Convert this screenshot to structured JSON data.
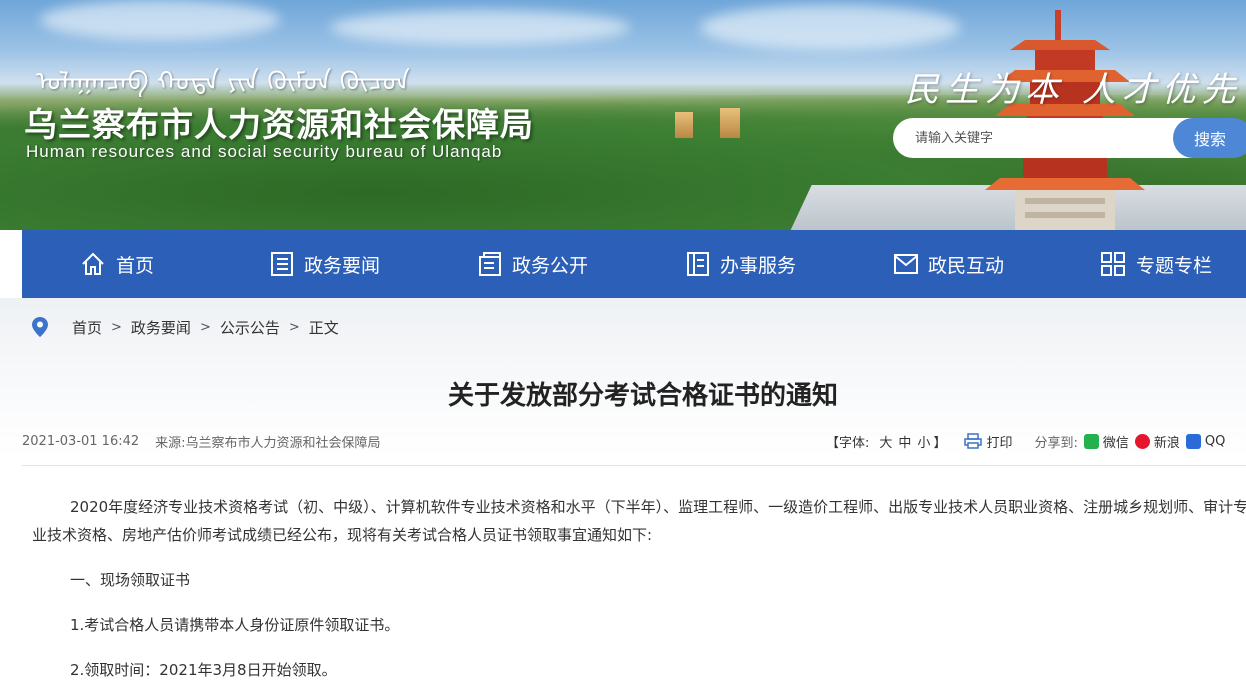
{
  "header": {
    "mongolian_title": "ᠤᠯᠠᠭᠠᠨᠴᠠᠪ ᠬᠣᠲᠠ ᠶᠢᠨ ᠬᠦᠮᠦᠨ ᠬᠦᠴᠦᠨ",
    "title": "乌兰察布市人力资源和社会保障局",
    "subtitle": "Human resources and social security bureau of Ulanqab",
    "slogan": "民生为本 人才优先"
  },
  "search": {
    "placeholder": "请输入关键字",
    "button_label": "搜索",
    "accent_color": "#4e87d6"
  },
  "nav": {
    "color": "#2c5fb8",
    "items": [
      {
        "label": "首页",
        "icon": "home-icon"
      },
      {
        "label": "政务要闻",
        "icon": "news-list-icon"
      },
      {
        "label": "政务公开",
        "icon": "open-affairs-icon"
      },
      {
        "label": "办事服务",
        "icon": "service-icon"
      },
      {
        "label": "政民互动",
        "icon": "mail-icon"
      },
      {
        "label": "专题专栏",
        "icon": "grid-icon"
      }
    ]
  },
  "breadcrumb": {
    "icon": "location-pin-icon",
    "items": [
      "首页",
      "政务要闻",
      "公示公告",
      "正文"
    ],
    "separator": ">"
  },
  "article": {
    "title": "关于发放部分考试合格证书的通知",
    "date": "2021-03-01 16:42",
    "source_label": "来源:",
    "source": "乌兰察布市人力资源和社会保障局",
    "font_label": "【字体:",
    "font_sizes": [
      "大",
      "中",
      "小"
    ],
    "font_close": "】",
    "print_label": "打印",
    "share_label": "分享到:",
    "share_targets": [
      {
        "label": "微信",
        "icon": "wechat-icon",
        "color": "#22b14c"
      },
      {
        "label": "新浪",
        "icon": "weibo-icon",
        "color": "#e6162d"
      },
      {
        "label": "QQ",
        "icon": "qq-icon",
        "color": "#2b6ad9"
      }
    ],
    "paragraphs": [
      "2020年度经济专业技术资格考试（初、中级）、计算机软件专业技术资格和水平（下半年）、监理工程师、一级造价工程师、出版专业技术人员职业资格、注册城乡规划师、审计专业技术资格、房地产估价师考试成绩已经公布，现将有关考试合格人员证书领取事宜通知如下:",
      "一、现场领取证书",
      "1.考试合格人员请携带本人身份证原件领取证书。",
      "2.领取时间：2021年3月8日开始领取。"
    ]
  }
}
